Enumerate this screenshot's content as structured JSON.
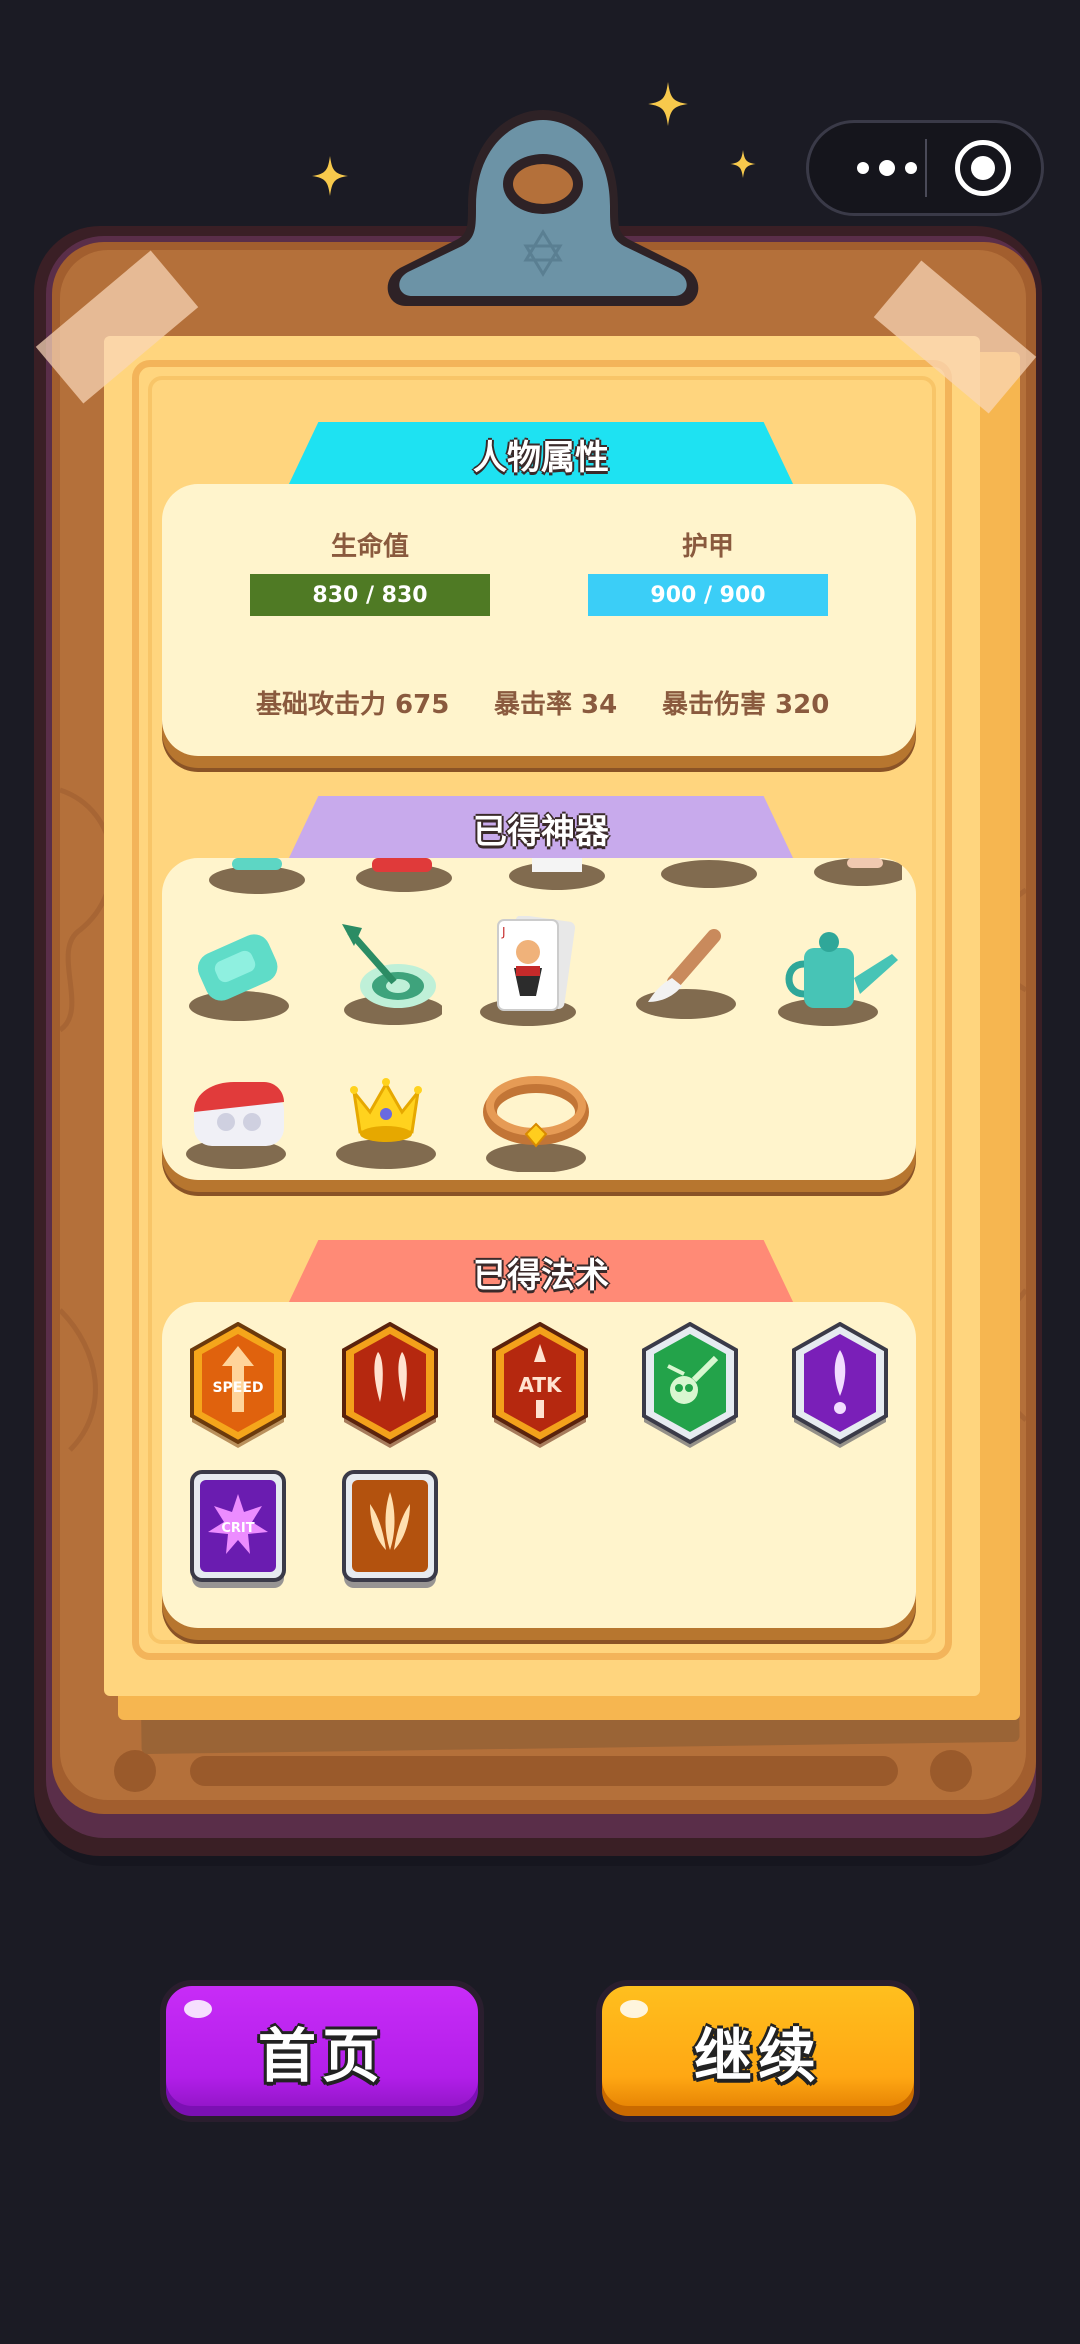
{
  "capsule": {
    "more_icon": "more-dots-icon",
    "close_icon": "target-circle-icon"
  },
  "sections": {
    "attributes": {
      "title": "人物属性",
      "hp_label": "生命值",
      "hp_value": "830 / 830",
      "armor_label": "护甲",
      "armor_value": "900 / 900",
      "attack": "基础攻击力 675",
      "crit_rate": "暴击率 34",
      "crit_damage": "暴击伤害 320"
    },
    "artifacts": {
      "title": "已得神器",
      "items": [
        "soap",
        "dart-target",
        "playing-card",
        "brush",
        "watering-can",
        "earbuds-case",
        "crown",
        "gold-ring"
      ]
    },
    "spells": {
      "title": "已得法术",
      "items": [
        {
          "icon": "speed-icon",
          "text": "SPEED"
        },
        {
          "icon": "double-claw-icon",
          "text": ""
        },
        {
          "icon": "atk-icon",
          "text": "ATK"
        },
        {
          "icon": "skull-icon",
          "text": ""
        },
        {
          "icon": "purple-bolt-icon",
          "text": ""
        },
        {
          "icon": "crit-icon",
          "text": "CRIT"
        },
        {
          "icon": "triple-shot-icon",
          "text": ""
        }
      ]
    }
  },
  "buttons": {
    "home": "首页",
    "continue": "继续"
  },
  "colors": {
    "hp": "#4f7a24",
    "armor": "#3bcef7",
    "home": "#b21ee9",
    "continue": "#ffa713"
  }
}
